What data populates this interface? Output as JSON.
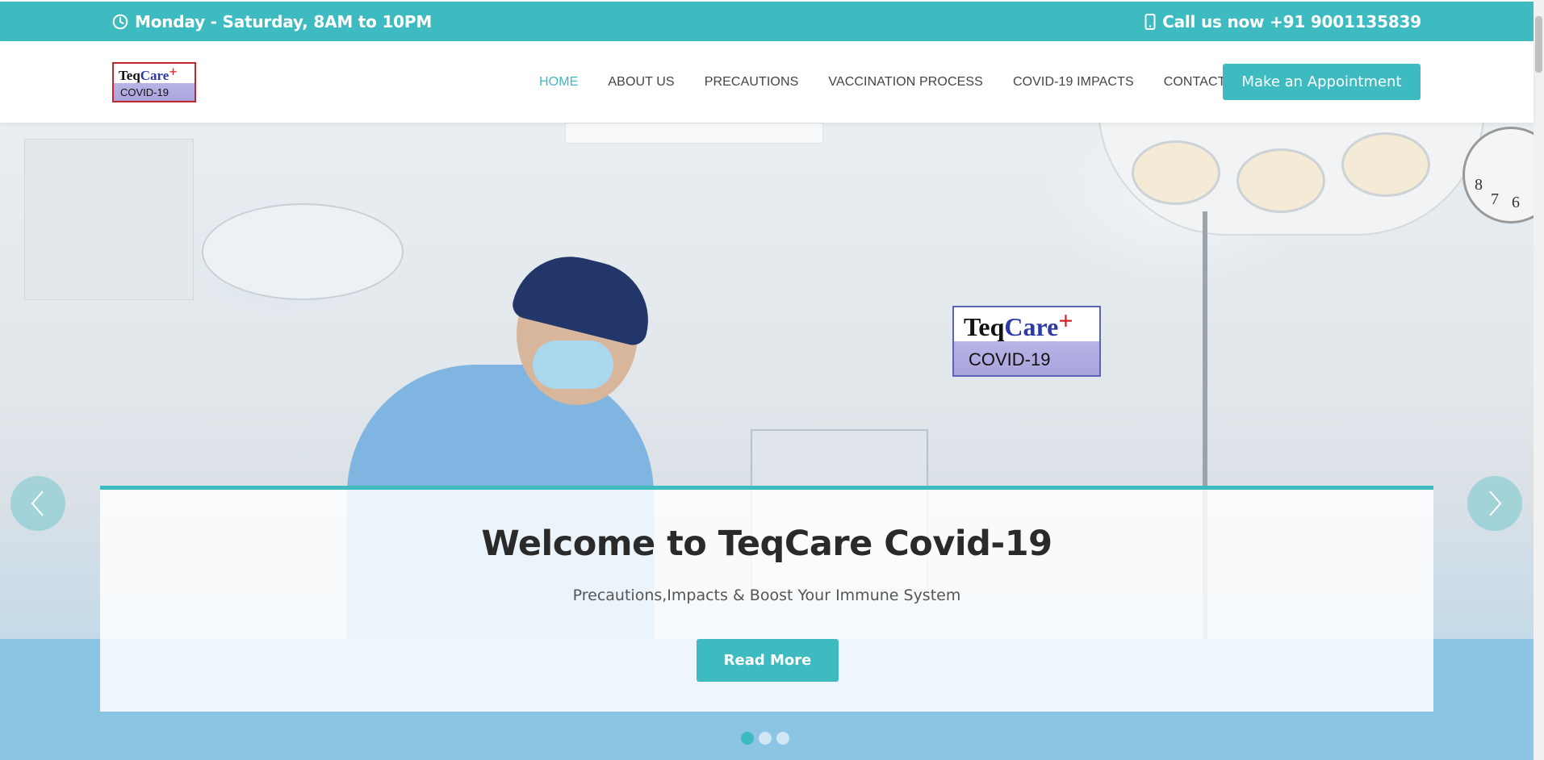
{
  "topbar": {
    "hours": "Monday - Saturday, 8AM to 10PM",
    "hours_icon": "clock-icon",
    "phone": "Call us now +91 9001135839",
    "phone_icon": "mobile-phone-icon",
    "background": "#3dbbc0"
  },
  "logo": {
    "part1": "Teq",
    "part2": "Care",
    "plus": "+",
    "sub": "COVID-19"
  },
  "nav": {
    "items": [
      {
        "label": "HOME",
        "active": true
      },
      {
        "label": "ABOUT US"
      },
      {
        "label": "PRECAUTIONS"
      },
      {
        "label": "VACCINATION PROCESS"
      },
      {
        "label": "COVID-19 IMPACTS"
      },
      {
        "label": "CONTACT"
      }
    ],
    "appointment_label": "Make an Appointment"
  },
  "hero": {
    "title": "Welcome to TeqCare Covid-19",
    "subtitle": "Precautions,Impacts & Boost Your Immune System",
    "button_label": "Read More",
    "slides": 3,
    "active_slide": 1,
    "accent": "#3dbbc0"
  }
}
